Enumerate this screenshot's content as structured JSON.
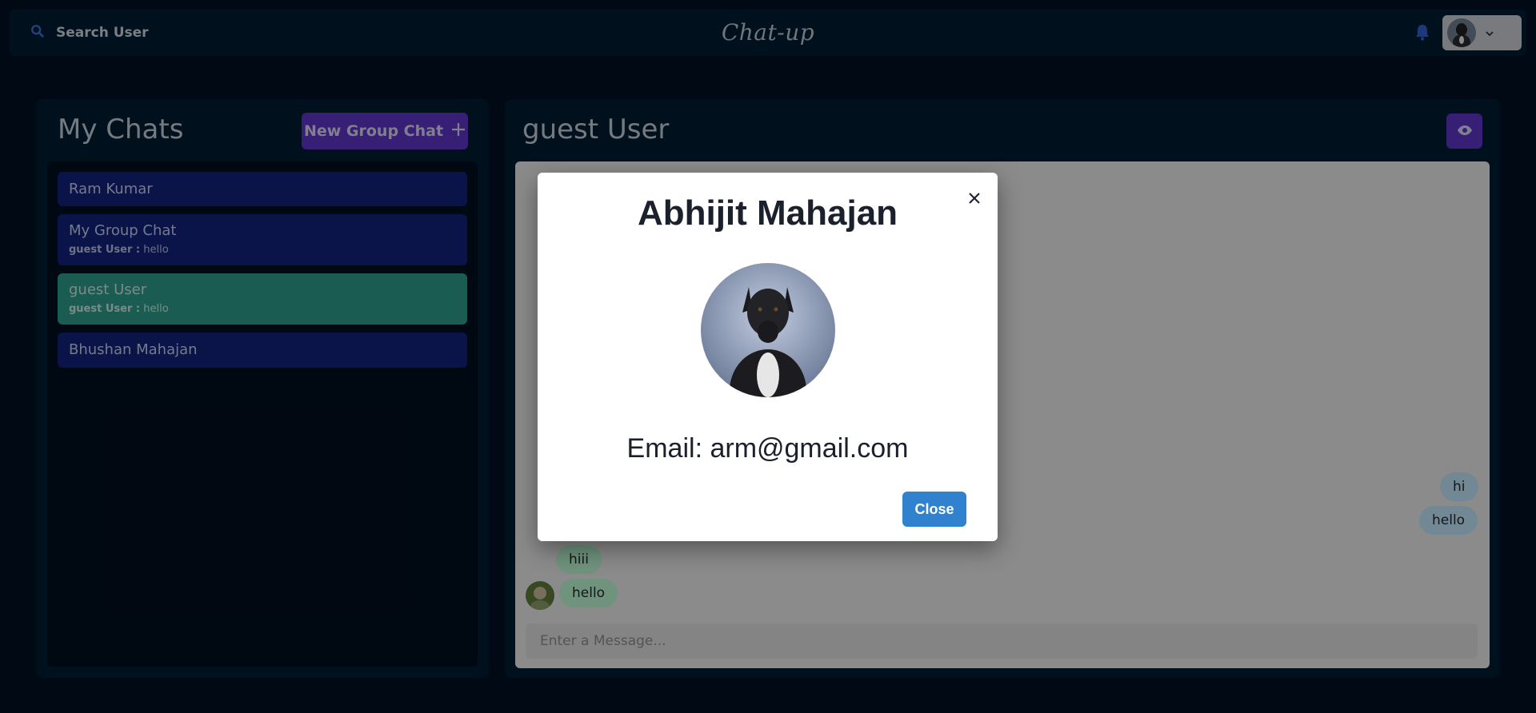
{
  "header": {
    "search_label": "Search User",
    "brand": "Chat-up"
  },
  "sidebar": {
    "title": "My Chats",
    "new_group_label": "New Group Chat",
    "chats": [
      {
        "name": "Ram Kumar",
        "latest_sender": "",
        "latest_text": ""
      },
      {
        "name": "My Group Chat",
        "latest_sender": "guest User :",
        "latest_text": "hello"
      },
      {
        "name": "guest User",
        "latest_sender": "guest User :",
        "latest_text": "hello",
        "active": true
      },
      {
        "name": "Bhushan Mahajan",
        "latest_sender": "",
        "latest_text": ""
      }
    ]
  },
  "chat": {
    "title": "guest User",
    "messages": [
      {
        "text": "hi",
        "from": "me"
      },
      {
        "text": "hello",
        "from": "me"
      },
      {
        "text": "hiii",
        "from": "other"
      },
      {
        "text": "hello",
        "from": "other"
      }
    ],
    "input_placeholder": "Enter a Message..."
  },
  "modal": {
    "name": "Abhijit Mahajan",
    "email": "Email: arm@gmail.com",
    "close_label": "Close"
  },
  "colors": {
    "accent": "#5b35c2",
    "active_chat": "#2c9a88",
    "chat_item": "#12227a",
    "primary_button": "#3182ce"
  }
}
